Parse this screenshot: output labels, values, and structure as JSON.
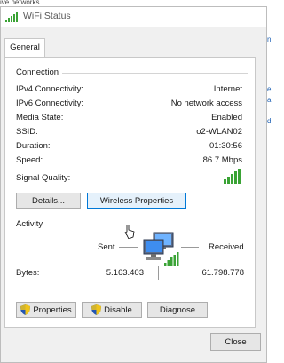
{
  "background": {
    "top_text": "ive networks",
    "right_marks": [
      "n",
      "e",
      "a",
      "d"
    ]
  },
  "window": {
    "title": "WiFi Status"
  },
  "tabs": [
    {
      "label": "General"
    }
  ],
  "connection": {
    "group_label": "Connection",
    "rows": [
      {
        "label": "IPv4 Connectivity:",
        "value": "Internet"
      },
      {
        "label": "IPv6 Connectivity:",
        "value": "No network access"
      },
      {
        "label": "Media State:",
        "value": "Enabled"
      },
      {
        "label": "SSID:",
        "value": "o2-WLAN02"
      },
      {
        "label": "Duration:",
        "value": "01:30:56"
      },
      {
        "label": "Speed:",
        "value": "86.7 Mbps"
      }
    ],
    "signal_quality_label": "Signal Quality:",
    "signal_bars": 5,
    "details_button": "Details...",
    "wireless_properties_button": "Wireless Properties"
  },
  "activity": {
    "group_label": "Activity",
    "sent_label": "Sent",
    "received_label": "Received",
    "bytes_label": "Bytes:",
    "bytes_sent": "5.163.403",
    "bytes_received": "61.798.778"
  },
  "actions": {
    "properties_button": "Properties",
    "disable_button": "Disable",
    "diagnose_button": "Diagnose"
  },
  "footer": {
    "close_button": "Close"
  },
  "colors": {
    "signal_green": "#3aa335",
    "focus_blue": "#0078d7",
    "panel_border": "#c8c8c8"
  },
  "icons": [
    "wifi-status-icon",
    "signal-bars-icon",
    "network-activity-icon",
    "uac-shield-icon",
    "mouse-pointer-icon"
  ]
}
